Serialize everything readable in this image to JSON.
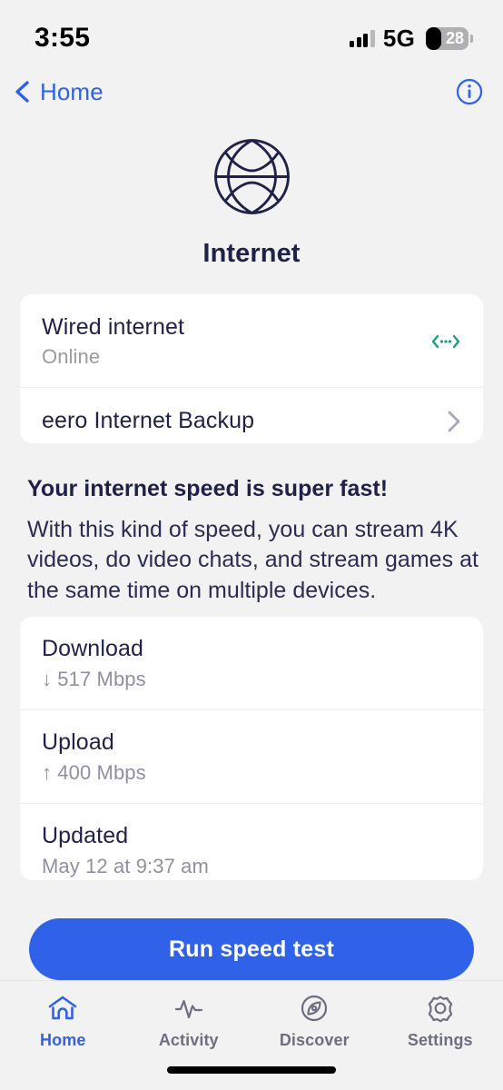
{
  "status_bar": {
    "time": "3:55",
    "network_type": "5G",
    "battery_percent": "28",
    "signal_icon": "cellular-signal-icon",
    "battery_icon": "battery-icon"
  },
  "nav": {
    "back_label": "Home",
    "back_icon": "chevron-left-icon",
    "info_icon": "info-circle-icon"
  },
  "hero": {
    "icon": "globe-icon",
    "title": "Internet"
  },
  "connection_card": {
    "rows": [
      {
        "title": "Wired internet",
        "subtitle": "Online",
        "accessory_icon": "data-transfer-icon"
      },
      {
        "title": "eero Internet Backup",
        "subtitle": "",
        "accessory_icon": "chevron-right-icon"
      }
    ]
  },
  "speed_summary": {
    "headline": "Your internet speed is super fast!",
    "body": "With this kind of speed, you can stream 4K videos, do video chats, and stream games at the same time on multiple devices."
  },
  "speed_stats": {
    "rows": [
      {
        "label": "Download",
        "value": "↓ 517 Mbps"
      },
      {
        "label": "Upload",
        "value": "↑ 400 Mbps"
      },
      {
        "label": "Updated",
        "value": "May 12 at 9:37 am"
      }
    ]
  },
  "cta": {
    "label": "Run speed test"
  },
  "tabbar": {
    "tabs": [
      {
        "label": "Home",
        "icon": "house-icon",
        "active": true
      },
      {
        "label": "Activity",
        "icon": "pulse-icon",
        "active": false
      },
      {
        "label": "Discover",
        "icon": "compass-icon",
        "active": false
      },
      {
        "label": "Settings",
        "icon": "gear-icon",
        "active": false
      }
    ]
  },
  "colors": {
    "accent_blue": "#2f62e8",
    "navy_text": "#1e2148",
    "muted_text": "#8f8fa1",
    "online_green": "#17a17c",
    "background": "#f2f2f3",
    "card": "#ffffff"
  }
}
